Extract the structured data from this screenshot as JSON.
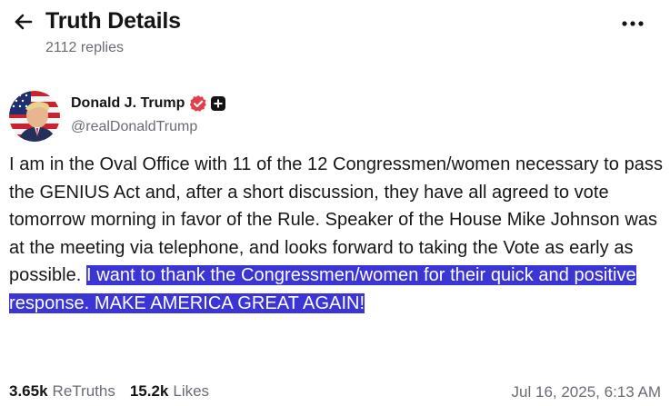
{
  "header": {
    "title": "Truth Details",
    "replies_count": "2112 replies",
    "back_icon": "arrow-left-icon",
    "more_icon": "ellipsis-horizontal-icon"
  },
  "author": {
    "name": "Donald J. Trump",
    "handle": "@realDonaldTrump",
    "verified_icon": "verified-badge-icon",
    "verified_color": "#e23e4c",
    "plus_icon": "plus-badge-icon"
  },
  "post": {
    "text_plain": "I am in the Oval Office with 11 of the 12 Congressmen/women necessary to pass the GENIUS Act and, after a short discussion, they have all agreed to vote tomorrow morning in favor of the Rule. Speaker of the House Mike Johnson was at the meeting via telephone, and looks forward to taking the Vote as early as possible. ",
    "text_highlighted": "I want to thank the Congressmen/women for their quick and positive response. MAKE AMERICA GREAT AGAIN!",
    "highlight_color": "#3b35d6"
  },
  "stats": {
    "retruths_count": "3.65k",
    "retruths_label": "ReTruths",
    "likes_count": "15.2k",
    "likes_label": "Likes"
  },
  "timestamp": "Jul 16, 2025, 6:13 AM"
}
